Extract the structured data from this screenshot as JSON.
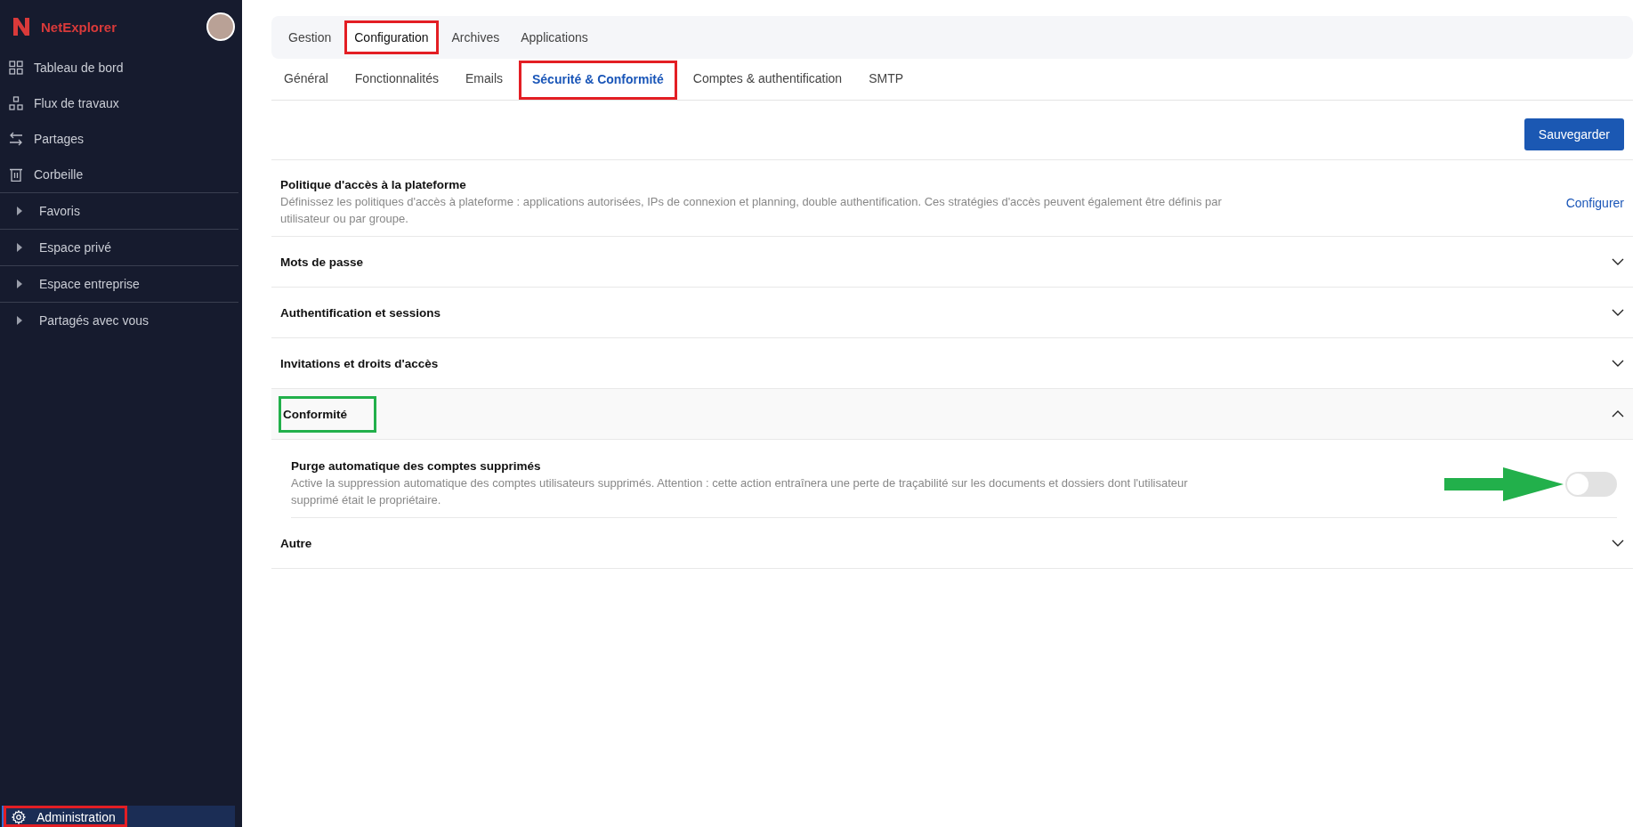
{
  "sidebar": {
    "brand": "NetExplorer",
    "nav_items": [
      {
        "label": "Tableau de bord",
        "kind": "grid"
      },
      {
        "label": "Flux de travaux",
        "kind": "flow"
      },
      {
        "label": "Partages",
        "kind": "swap"
      },
      {
        "label": "Corbeille",
        "kind": "trash"
      }
    ],
    "tree_items": [
      {
        "label": "Favoris",
        "expanded": false
      },
      {
        "label": "Espace privé",
        "expanded": false
      },
      {
        "label": "Espace entreprise",
        "expanded": false
      },
      {
        "label": "Partagés avec vous",
        "expanded": false
      }
    ],
    "footer_item": {
      "label": "Administration",
      "selected": true,
      "color": "#e31e24"
    }
  },
  "tabs": [
    {
      "label": "Gestion",
      "selected": false
    },
    {
      "label": "Configuration",
      "selected": true,
      "color": "#e31e24"
    },
    {
      "label": "Archives",
      "selected": false
    },
    {
      "label": "Applications",
      "selected": false
    }
  ],
  "subtabs": [
    {
      "label": "Général",
      "selected": false
    },
    {
      "label": "Fonctionnalités",
      "selected": false
    },
    {
      "label": "Emails",
      "selected": false
    },
    {
      "label": "Sécurité & Conformité",
      "selected": true,
      "color": "#e31e24"
    },
    {
      "label": "Comptes & authentification",
      "selected": false
    },
    {
      "label": "SMTP",
      "selected": false
    }
  ],
  "save_button": "Sauvegarder",
  "policy": {
    "title": "Politique d'accès à la plateforme",
    "description": "Définissez les politiques d'accès à plateforme : applications autorisées, IPs de connexion et planning, double authentification. Ces stratégies d'accès peuvent également être définis par utilisateur ou par groupe.",
    "link": "Configurer"
  },
  "sections": [
    {
      "title": "Mots de passe",
      "expanded": false
    },
    {
      "title": "Authentification et sessions",
      "expanded": false
    },
    {
      "title": "Invitations et droits d'accès",
      "expanded": false
    },
    {
      "title": "Conformité",
      "expanded": true,
      "color": "#22b04b",
      "settings": [
        {
          "title": "Purge automatique des comptes supprimés",
          "description": "Active la suppression automatique des comptes utilisateurs supprimés. Attention : cette action entraînera une perte de traçabilité sur les documents et dossiers dont l'utilisateur supprimé était le propriétaire.",
          "on": false,
          "pointer": true
        }
      ]
    },
    {
      "title": "Autre",
      "expanded": false
    }
  ]
}
